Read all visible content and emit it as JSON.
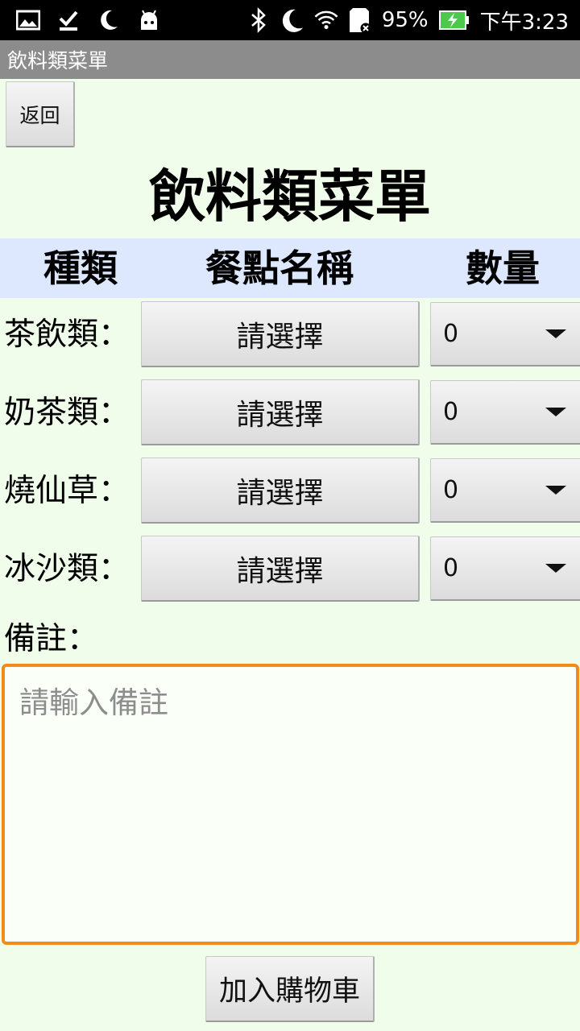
{
  "status_bar": {
    "battery": "95%",
    "time": "下午3:23",
    "icons": [
      "image-icon",
      "download-done-icon",
      "moon-icon",
      "android-icon",
      "bluetooth-icon",
      "dnd-moon-icon",
      "wifi-icon",
      "sd-card-icon",
      "battery-charging-icon"
    ]
  },
  "app_bar": {
    "title": "飲料類菜單"
  },
  "back_button": {
    "label": "返回"
  },
  "page_title": "飲料類菜單",
  "table_header": {
    "type": "種類",
    "name": "餐點名稱",
    "qty": "數量"
  },
  "rows": [
    {
      "label": "茶飲類：",
      "select_label": "請選擇",
      "qty": "0"
    },
    {
      "label": "奶茶類：",
      "select_label": "請選擇",
      "qty": "0"
    },
    {
      "label": "燒仙草：",
      "select_label": "請選擇",
      "qty": "0"
    },
    {
      "label": "冰沙類：",
      "select_label": "請選擇",
      "qty": "0"
    }
  ],
  "note": {
    "label": "備註：",
    "placeholder": "請輸入備註",
    "value": ""
  },
  "cart_button": {
    "label": "加入購物車"
  },
  "colors": {
    "background": "#f0fdea",
    "header_band": "#dde8fe",
    "focus_border": "#f08c1e",
    "app_bar": "#8c8c8c"
  }
}
